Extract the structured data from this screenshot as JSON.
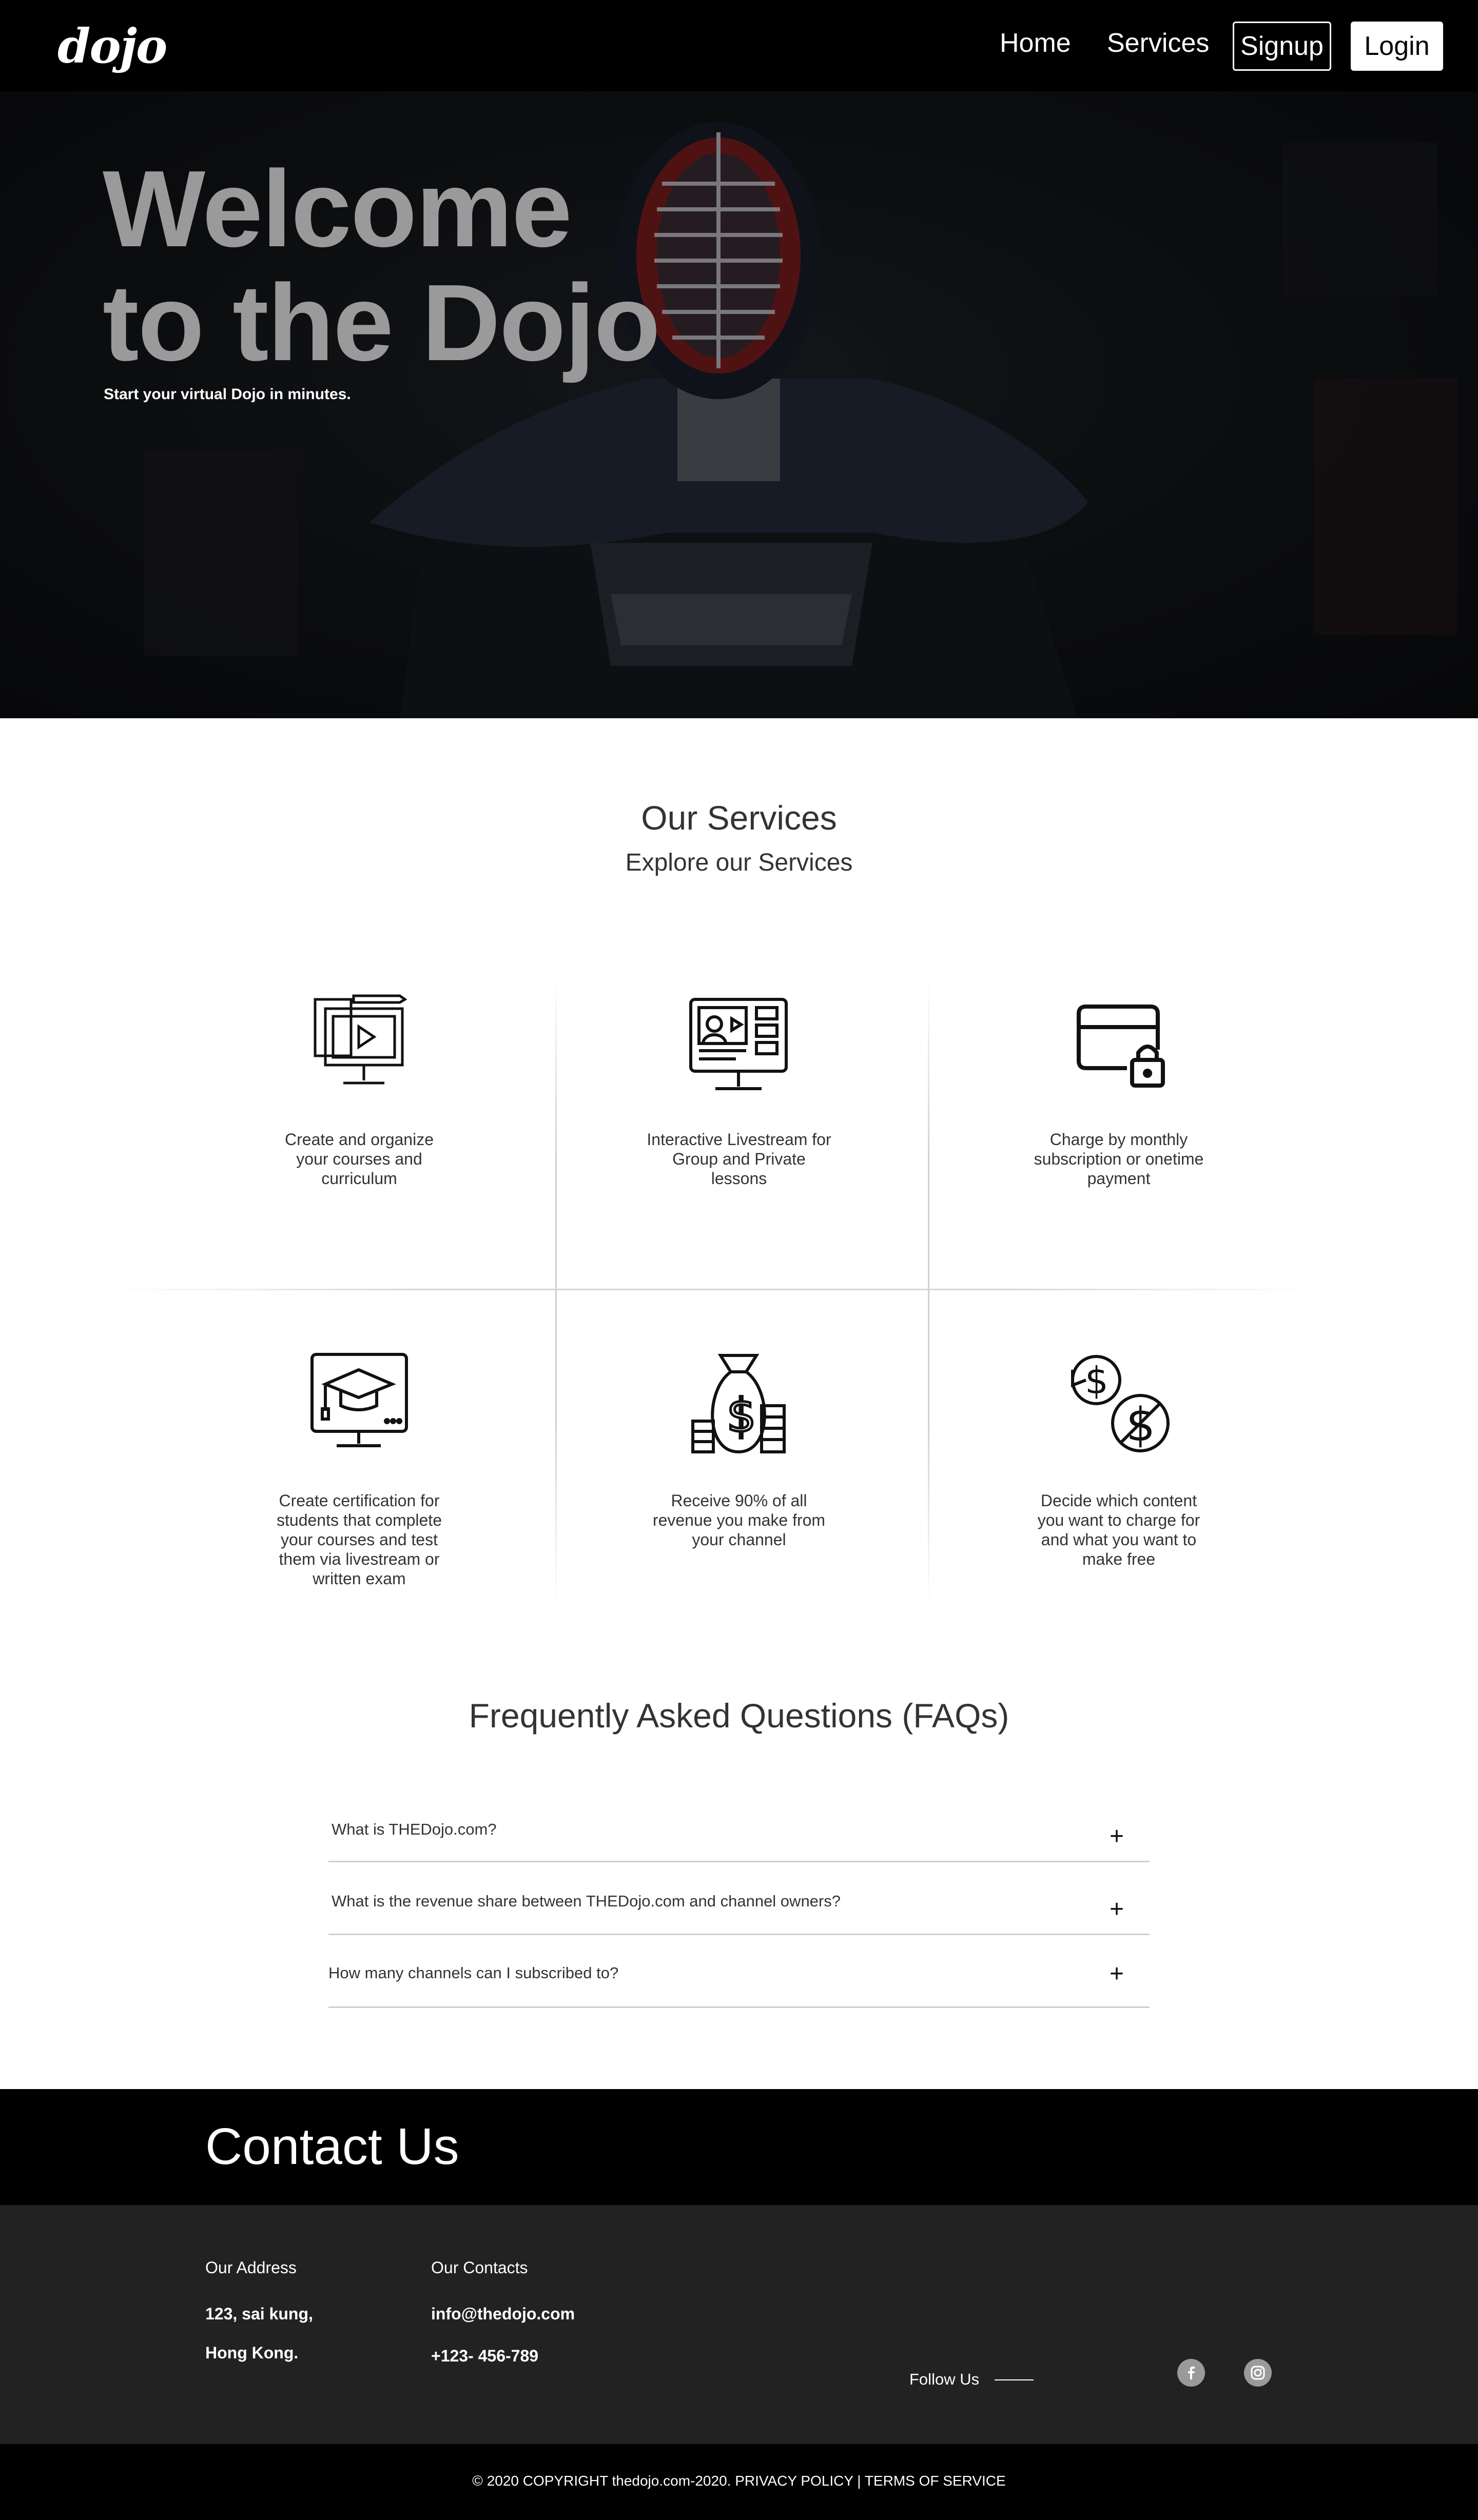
{
  "nav": {
    "logo": "dojo",
    "home": "Home",
    "services": "Services",
    "signup": "Signup",
    "login": "Login"
  },
  "hero": {
    "title_line1": "Welcome",
    "title_line2": "to the Dojo",
    "subtitle": "Start your virtual Dojo in minutes."
  },
  "services": {
    "title": "Our Services",
    "subtitle": "Explore our Services",
    "items": [
      {
        "icon": "course-monitor-icon",
        "text": "Create and organize your courses and curriculum"
      },
      {
        "icon": "livestream-screen-icon",
        "text": "Interactive Livestream for Group and Private lessons"
      },
      {
        "icon": "card-lock-icon",
        "text": "Charge by monthly subscription or onetime payment"
      },
      {
        "icon": "graduation-monitor-icon",
        "text": "Create certification for students that complete your courses and test them via livestream or written exam"
      },
      {
        "icon": "money-bag-icon",
        "text": "Receive 90% of all revenue you make from your channel"
      },
      {
        "icon": "free-paid-dollar-icon",
        "text": "Decide which content you want to charge for and what you want to make free"
      }
    ]
  },
  "faq": {
    "title": "Frequently Asked Questions (FAQs)",
    "items": [
      {
        "question": "What is THEDojo.com?",
        "toggle": "+"
      },
      {
        "question": "What is the revenue share between THEDojo.com and channel owners?",
        "toggle": "+"
      },
      {
        "question": "How many channels can I subscribed to?",
        "toggle": "+"
      }
    ]
  },
  "contact": {
    "title": "Contact Us",
    "address_heading": "Our Address",
    "address_line1": "123, sai kung,",
    "address_line2": "Hong Kong.",
    "contacts_heading": "Our Contacts",
    "email": "info@thedojo.com",
    "phone": "+123- 456-789",
    "follow_us": "Follow Us",
    "social": [
      "facebook-icon",
      "instagram-icon"
    ]
  },
  "footer": {
    "copyright": "© 2020  COPYRIGHT  thedojo.com-2020.  PRIVACY POLICY   |   TERMS OF SERVICE"
  }
}
